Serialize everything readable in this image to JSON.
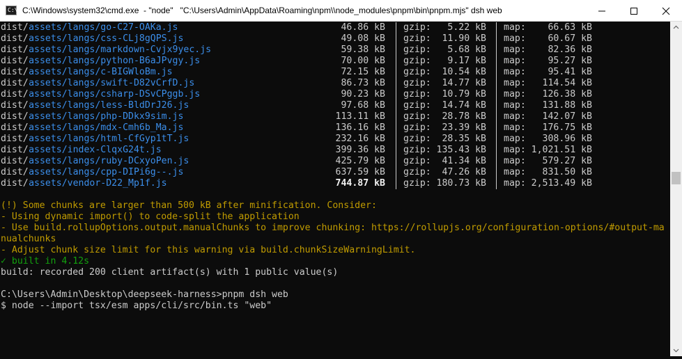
{
  "window": {
    "icon_label": "C:\\",
    "title": "C:\\Windows\\system32\\cmd.exe  - \"node\"   \"C:\\Users\\Admin\\AppData\\Roaming\\npm\\\\node_modules\\pnpm\\bin\\pnpm.mjs\" dsh web"
  },
  "colors": {
    "background": "#0c0c0c",
    "text": "#cccccc",
    "path_blue": "#3b8eea",
    "warning_yellow": "#c19c00",
    "success_green": "#13a10e"
  },
  "build_output": [
    {
      "dir": "dist/",
      "file": "assets/langs/go-C27-OAKa.js",
      "size": "46.86 kB",
      "gzip": "5.22 kB",
      "map": "66.63 kB"
    },
    {
      "dir": "dist/",
      "file": "assets/langs/css-CLj8gQPS.js",
      "size": "49.08 kB",
      "gzip": "11.90 kB",
      "map": "60.67 kB"
    },
    {
      "dir": "dist/",
      "file": "assets/langs/markdown-Cvjx9yec.js",
      "size": "59.38 kB",
      "gzip": "5.68 kB",
      "map": "82.36 kB"
    },
    {
      "dir": "dist/",
      "file": "assets/langs/python-B6aJPvgy.js",
      "size": "70.00 kB",
      "gzip": "9.17 kB",
      "map": "95.27 kB"
    },
    {
      "dir": "dist/",
      "file": "assets/langs/c-BIGWloBm.js",
      "size": "72.15 kB",
      "gzip": "10.54 kB",
      "map": "95.41 kB"
    },
    {
      "dir": "dist/",
      "file": "assets/langs/swift-D82vCrfD.js",
      "size": "86.73 kB",
      "gzip": "14.77 kB",
      "map": "114.54 kB"
    },
    {
      "dir": "dist/",
      "file": "assets/langs/csharp-DSvCPggb.js",
      "size": "90.23 kB",
      "gzip": "10.79 kB",
      "map": "126.38 kB"
    },
    {
      "dir": "dist/",
      "file": "assets/langs/less-BldDrJ26.js",
      "size": "97.68 kB",
      "gzip": "14.74 kB",
      "map": "131.88 kB"
    },
    {
      "dir": "dist/",
      "file": "assets/langs/php-DDkx9sim.js",
      "size": "113.11 kB",
      "gzip": "28.78 kB",
      "map": "142.07 kB"
    },
    {
      "dir": "dist/",
      "file": "assets/langs/mdx-Cmh6b_Ma.js",
      "size": "136.16 kB",
      "gzip": "23.39 kB",
      "map": "176.75 kB"
    },
    {
      "dir": "dist/",
      "file": "assets/langs/html-CfGyp1tT.js",
      "size": "232.16 kB",
      "gzip": "28.35 kB",
      "map": "308.96 kB"
    },
    {
      "dir": "dist/",
      "file": "assets/index-ClqxG24t.js",
      "size": "399.36 kB",
      "gzip": "135.43 kB",
      "map": "1,021.51 kB"
    },
    {
      "dir": "dist/",
      "file": "assets/langs/ruby-DCxyoPen.js",
      "size": "425.79 kB",
      "gzip": "41.34 kB",
      "map": "579.27 kB"
    },
    {
      "dir": "dist/",
      "file": "assets/langs/cpp-DIPi6g--.js",
      "size": "637.59 kB",
      "gzip": "47.26 kB",
      "map": "831.50 kB"
    },
    {
      "dir": "dist/",
      "file": "assets/vendor-D22_Mp1f.js",
      "size": "744.87 kB",
      "gzip": "180.73 kB",
      "map": "2,513.49 kB"
    }
  ],
  "labels": {
    "gzip": "gzip:",
    "map": "map:"
  },
  "warning": {
    "line1": "(!) Some chunks are larger than 500 kB after minification. Consider:",
    "line2": "- Using dynamic import() to code-split the application",
    "line3": "- Use build.rollupOptions.output.manualChunks to improve chunking: https://rollupjs.org/configuration-options/#output-ma",
    "line4": "nualchunks",
    "line5": "- Adjust chunk size limit for this warning via build.chunkSizeWarningLimit."
  },
  "built": {
    "check": "✓",
    "text": " built in 4.12s"
  },
  "recorded": "build: recorded 200 client artifact(s) with 1 public value(s)",
  "prompt": "C:\\Users\\Admin\\Desktop\\deepseek-harness>pnpm dsh web",
  "command": "$ node --import tsx/esm apps/cli/src/bin.ts \"web\""
}
